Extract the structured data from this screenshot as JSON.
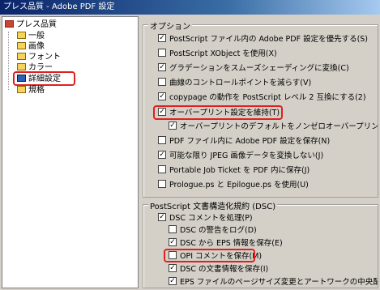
{
  "window": {
    "title": "プレス品質 - Adobe PDF 設定"
  },
  "tree": {
    "root": {
      "label": "プレス品質",
      "expander": "−"
    },
    "items": [
      {
        "label": "一般"
      },
      {
        "label": "画像"
      },
      {
        "label": "フォント"
      },
      {
        "label": "カラー"
      },
      {
        "label": "詳細設定",
        "selected": true
      },
      {
        "label": "規格"
      }
    ]
  },
  "options": {
    "title": "オプション",
    "items": [
      {
        "label": "PostScript ファイル内の Adobe PDF 設定を優先する(S)",
        "checked": true
      },
      {
        "label": "PostScript XObject を使用(X)",
        "checked": false
      },
      {
        "label": "グラデーションをスムーズシェーディングに変換(C)",
        "checked": true
      },
      {
        "label": "曲線のコントロールポイントを減らす(V)",
        "checked": false
      },
      {
        "label": "copypage の動作を PostScript レベル 2 互換にする(2)",
        "checked": true
      },
      {
        "label": "オーバープリント設定を維持(T)",
        "checked": true
      },
      {
        "label": "オーバープリントのデフォルトをノンゼロオーバープリントにする(Z)",
        "checked": true
      },
      {
        "label": "PDF ファイル内に Adobe PDF 設定を保存(N)",
        "checked": false
      },
      {
        "label": "可能な限り JPEG 画像データを変換しない(J)",
        "checked": true
      },
      {
        "label": "Portable Job Ticket を PDF 内に保存(J)",
        "checked": false
      },
      {
        "label": "Prologue.ps と Epilogue.ps を使用(U)",
        "checked": false
      }
    ]
  },
  "dsc": {
    "title": "PostScript 文書構造化規約 (DSC)",
    "items": [
      {
        "label": "DSC コメントを処理(P)",
        "checked": true
      },
      {
        "label": "DSC の警告をログ(D)",
        "checked": false
      },
      {
        "label": "DSC から EPS 情報を保存(E)",
        "checked": true
      },
      {
        "label": "OPI コメントを保存(M)",
        "checked": false
      },
      {
        "label": "DSC の文書情報を保存(I)",
        "checked": true
      },
      {
        "label": "EPS ファイルのページサイズ変更とアートワークの中央配置(R)",
        "checked": true
      }
    ]
  }
}
